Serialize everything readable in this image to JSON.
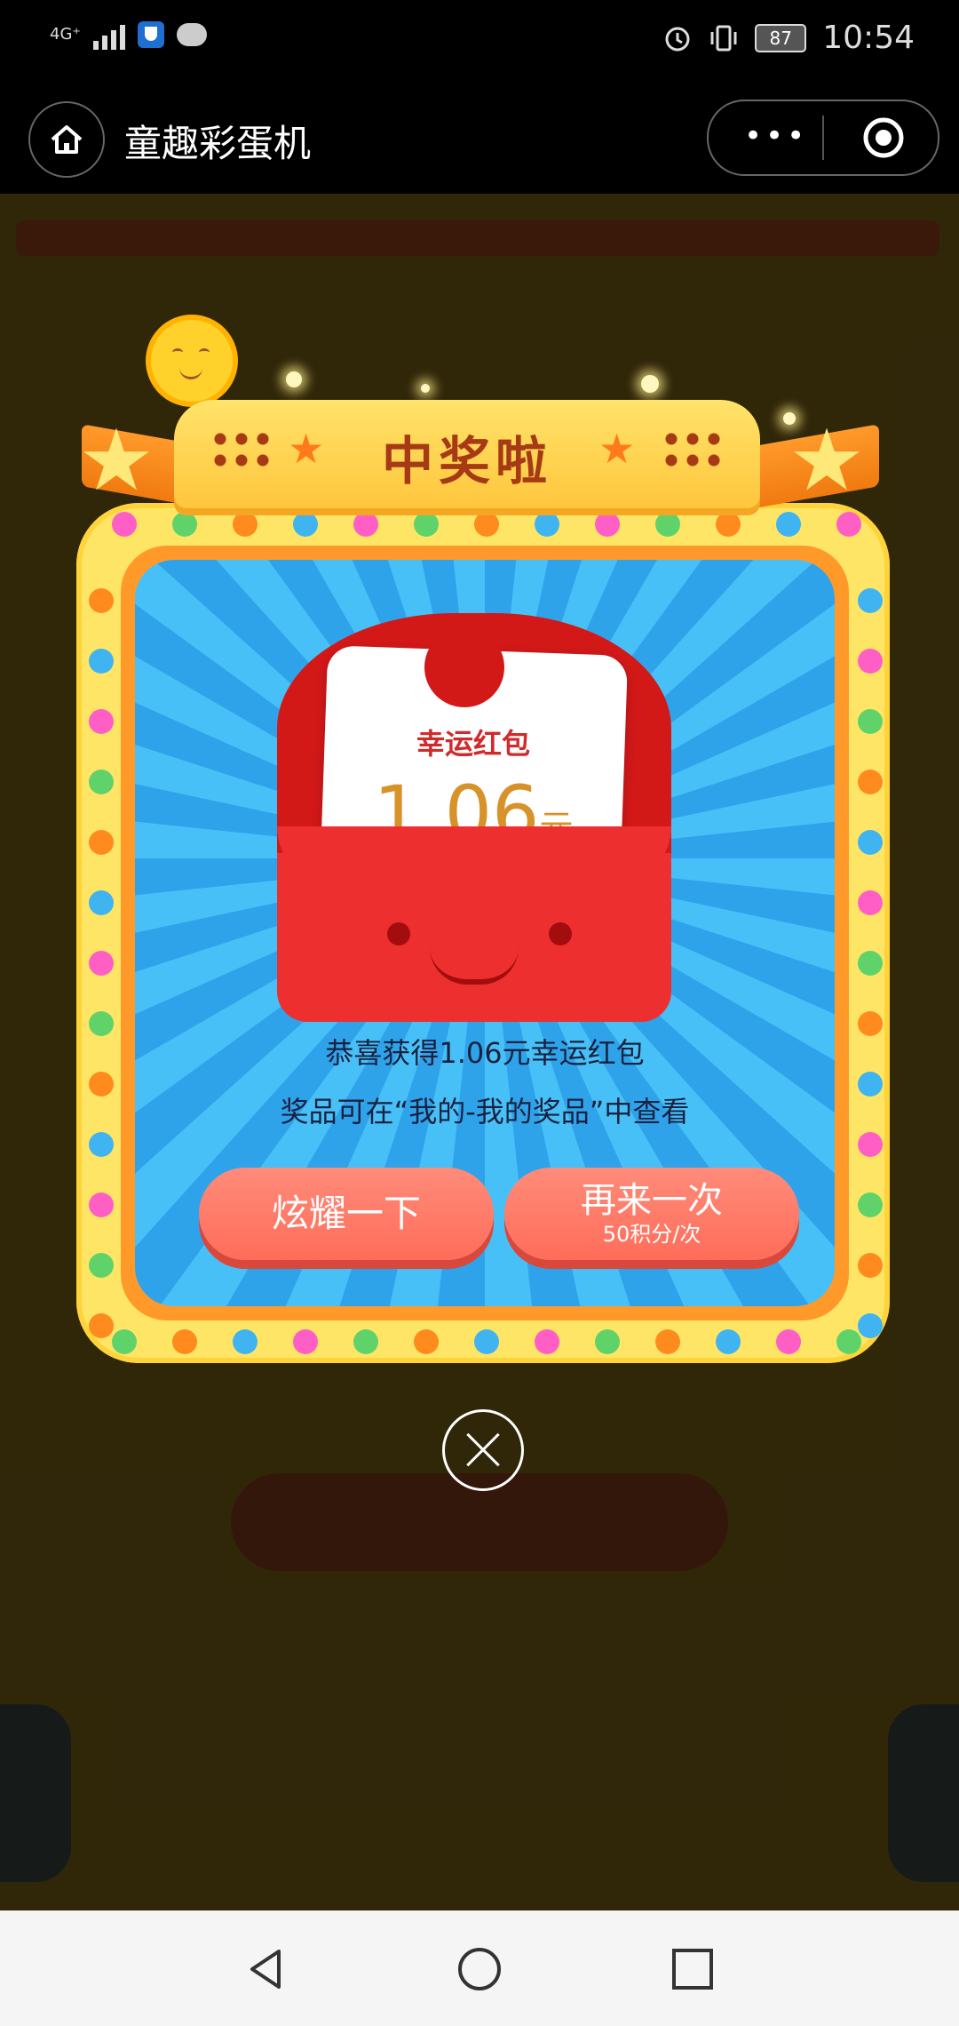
{
  "status_bar": {
    "network": "4G⁺",
    "time": "10:54",
    "battery": "87"
  },
  "nav": {
    "title": "童趣彩蛋机",
    "more_glyph": "•••"
  },
  "popup": {
    "banner_title": "中奖啦",
    "card_title": "幸运红包",
    "amount": "1.06",
    "unit": "元",
    "message_line1": "恭喜获得1.06元幸运红包",
    "message_line2": "奖品可在“我的-我的奖品”中查看",
    "share_button": "炫耀一下",
    "again_button": "再来一次",
    "again_cost": "50积分/次"
  },
  "icons": {
    "home": "home-icon",
    "more": "more-icon",
    "target": "target-icon",
    "close": "close-icon",
    "back": "back-icon",
    "home_nav": "circle-home-icon",
    "recent": "square-recent-icon"
  },
  "colors": {
    "accent_red": "#ee2f2f",
    "button_coral": "#ff7a67",
    "frame_yellow": "#ffe566",
    "frame_orange": "#ff9a2a",
    "panel_blue": "#3bb3f0"
  }
}
